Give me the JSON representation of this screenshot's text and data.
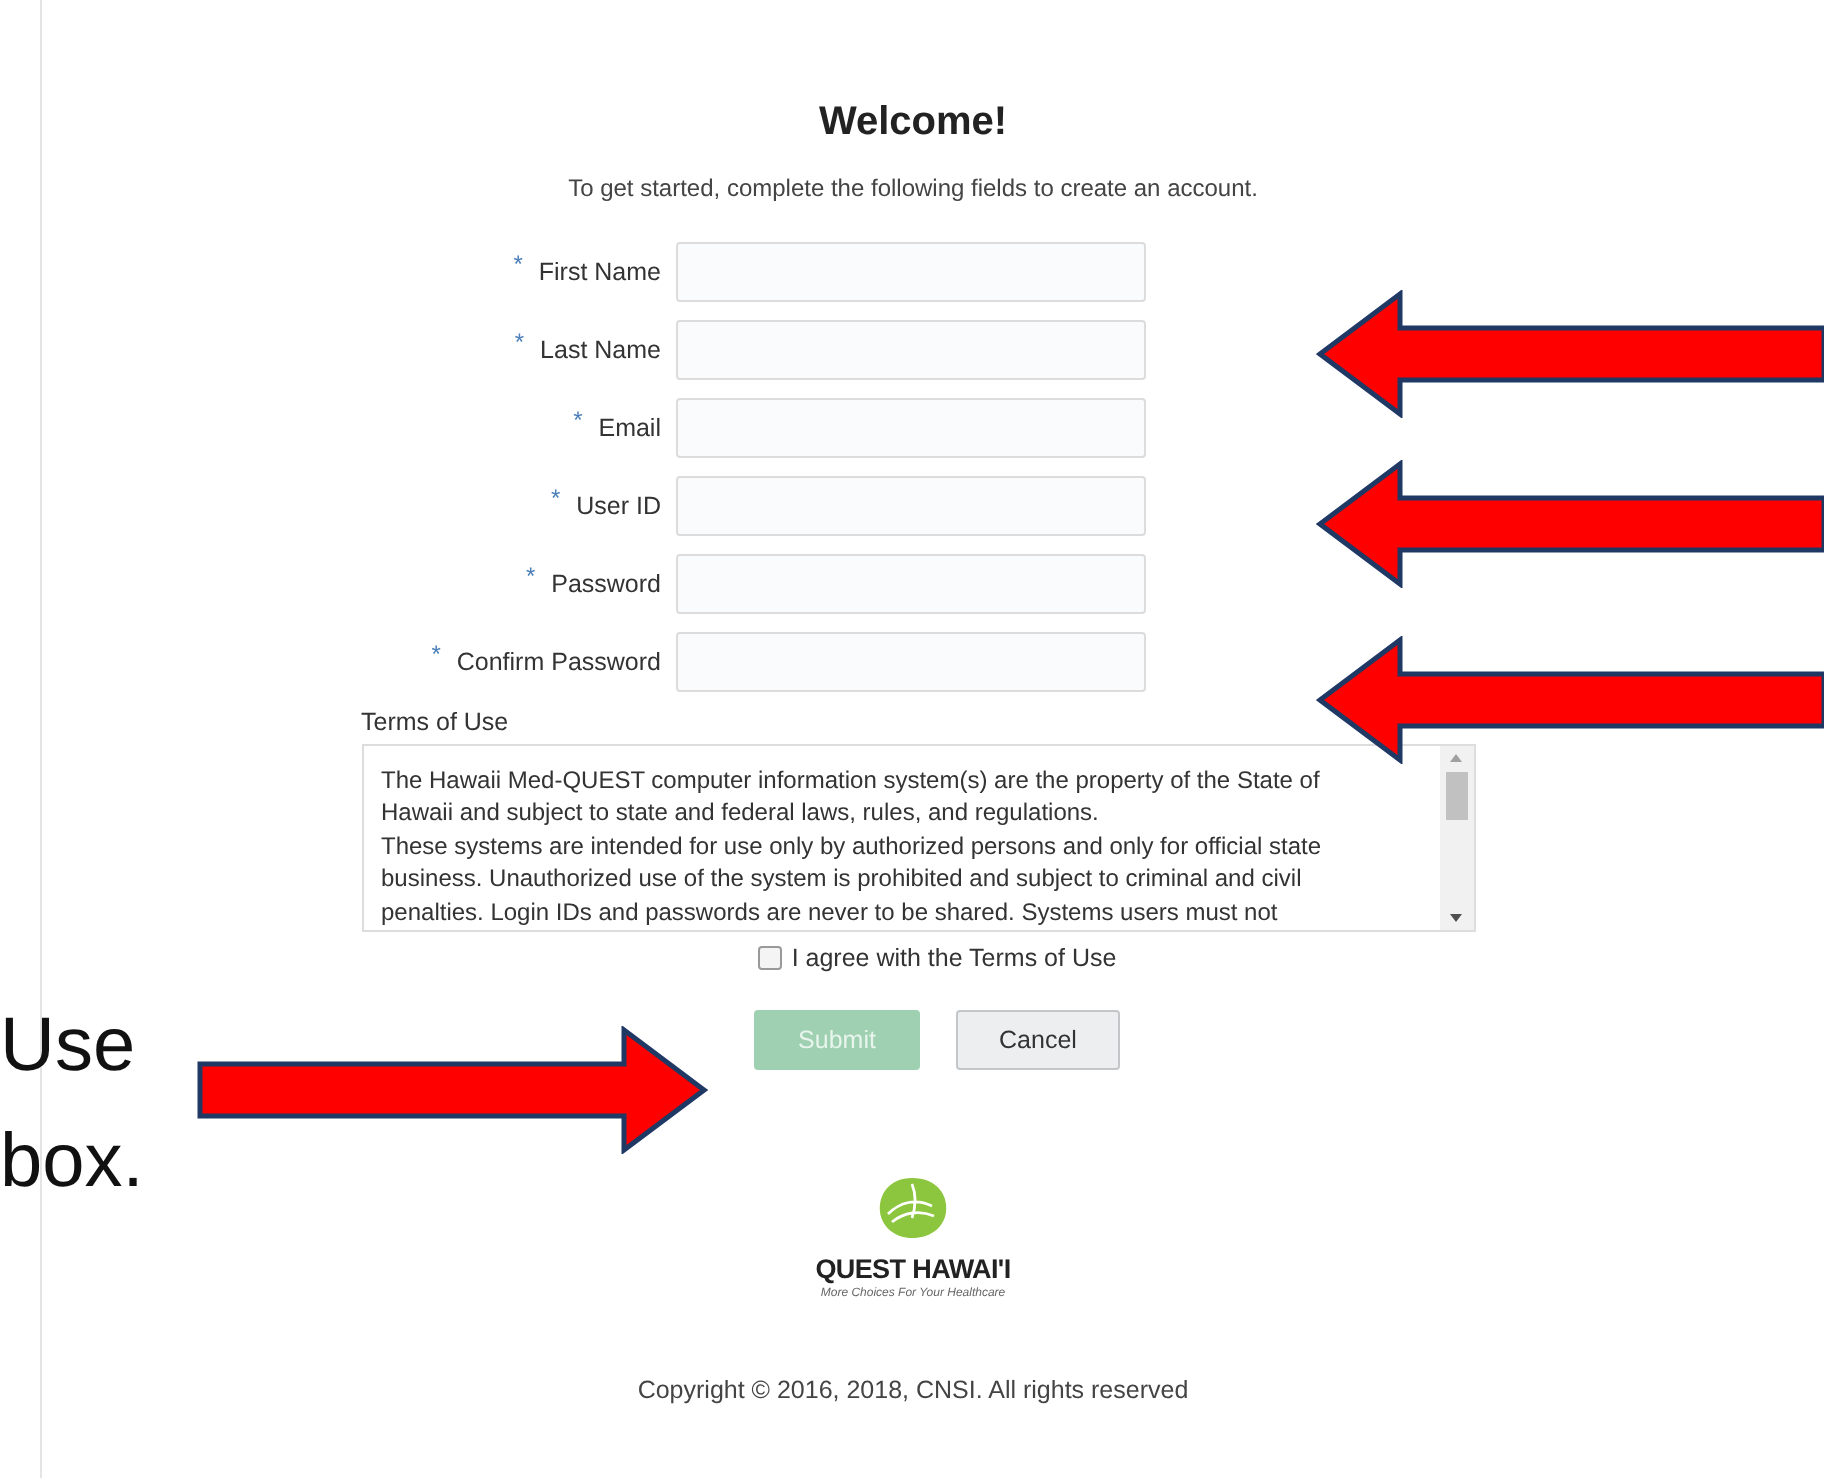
{
  "title": "Welcome!",
  "subtitle": "To get started, complete the following fields to create an account.",
  "fields": [
    {
      "label": "First Name",
      "required_mark": "*"
    },
    {
      "label": "Last Name",
      "required_mark": "*"
    },
    {
      "label": "Email",
      "required_mark": "*"
    },
    {
      "label": "User ID",
      "required_mark": "*"
    },
    {
      "label": "Password",
      "required_mark": "*"
    },
    {
      "label": "Confirm Password",
      "required_mark": "*"
    }
  ],
  "terms": {
    "label": "Terms of Use",
    "paragraphs": [
      "The Hawaii Med-QUEST computer information system(s) are the property of the State of Hawaii and subject to state and federal laws, rules, and regulations.",
      "These systems are intended for use only by authorized persons and only for official state business. Unauthorized use of the system is prohibited and subject to criminal and civil penalties. Login IDs and passwords are never to be shared. Systems users must not"
    ]
  },
  "agree": {
    "label": "I agree with the Terms of Use",
    "checked": false
  },
  "buttons": [
    {
      "label": "Submit",
      "kind": "primary",
      "disabled": true
    },
    {
      "label": "Cancel",
      "kind": "secondary",
      "disabled": false
    }
  ],
  "logo": {
    "name": "QUEST HAWAI'I",
    "tagline": "More Choices For Your Healthcare"
  },
  "copyright": "Copyright © 2016, 2018, CNSI. All rights reserved",
  "callout": {
    "lines": [
      "Use",
      "box."
    ]
  },
  "arrows": [
    {
      "kind": "left"
    },
    {
      "kind": "left"
    },
    {
      "kind": "left"
    },
    {
      "kind": "right"
    }
  ]
}
